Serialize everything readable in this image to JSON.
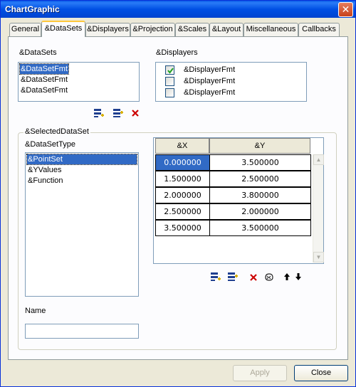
{
  "window": {
    "title": "ChartGraphic",
    "close_glyph": "✕"
  },
  "tabs": [
    {
      "label": "General"
    },
    {
      "label": "&DataSets"
    },
    {
      "label": "&Displayers"
    },
    {
      "label": "&Projection"
    },
    {
      "label": "&Scales"
    },
    {
      "label": "&Layout"
    },
    {
      "label": "Miscellaneous"
    },
    {
      "label": "Callbacks"
    }
  ],
  "active_tab": "&DataSets",
  "datasets": {
    "label": "&DataSets",
    "items": [
      "&DataSetFmt",
      "&DataSetFmt",
      "&DataSetFmt"
    ],
    "selected_index": 0,
    "toolbar_icons": [
      "add-dataset-icon",
      "insert-dataset-icon",
      "delete-icon"
    ]
  },
  "displayers": {
    "label": "&Displayers",
    "items": [
      {
        "label": "&DisplayerFmt",
        "checked": true
      },
      {
        "label": "&DisplayerFmt",
        "checked": false
      },
      {
        "label": "&DisplayerFmt",
        "checked": false
      }
    ]
  },
  "selected_dataset": {
    "group_label": "&SelectedDataSet",
    "type_label": "&DataSetType",
    "types": [
      "&PointSet",
      "&YValues",
      "&Function"
    ],
    "selected_type_index": 0,
    "name_label": "Name",
    "name_value": ""
  },
  "grid": {
    "headers": [
      "&X",
      "&Y"
    ],
    "rows": [
      [
        "0.000000",
        "3.500000"
      ],
      [
        "1.500000",
        "2.500000"
      ],
      [
        "2.000000",
        "3.800000"
      ],
      [
        "2.500000",
        "2.000000"
      ],
      [
        "3.500000",
        "3.500000"
      ]
    ],
    "selected_cell": [
      0,
      0
    ],
    "toolbar_icons": [
      "add-row-icon",
      "insert-row-icon",
      "delete-icon",
      "sort-icon",
      "move-up-icon",
      "move-down-icon"
    ]
  },
  "buttons": {
    "apply": "Apply",
    "close": "Close"
  },
  "colors": {
    "selection": "#316ac5",
    "titlebar": "#0050e4",
    "delete": "#cc0000"
  }
}
